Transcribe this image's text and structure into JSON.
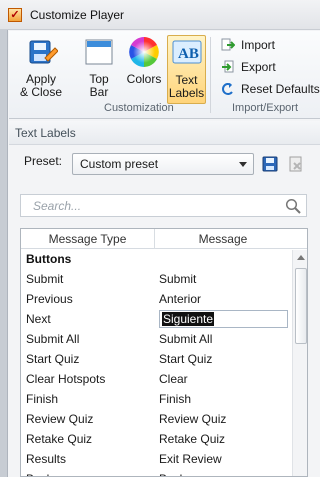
{
  "window": {
    "title": "Customize Player",
    "app_icon": "✓"
  },
  "ribbon": {
    "apply_label": "Apply\n& Close",
    "topbar_label": "Top\nBar",
    "colors_label": "Colors",
    "textlabels_label": "Text\nLabels",
    "customization_group": "Customization",
    "import_label": "Import",
    "export_label": "Export",
    "reset_label": "Reset Defaults",
    "importexport_group": "Import/Export"
  },
  "panel": {
    "title": "Text Labels"
  },
  "preset": {
    "label": "Preset:",
    "value": "Custom preset"
  },
  "search": {
    "placeholder": "Search..."
  },
  "grid": {
    "headers": [
      "Message Type",
      "Message"
    ],
    "group": "Buttons",
    "rows": [
      [
        "Submit",
        "Submit"
      ],
      [
        "Previous",
        "Anterior"
      ],
      [
        "Next",
        "Siguiente"
      ],
      [
        "Submit All",
        "Submit All"
      ],
      [
        "Start Quiz",
        "Start Quiz"
      ],
      [
        "Clear Hotspots",
        "Clear"
      ],
      [
        "Finish",
        "Finish"
      ],
      [
        "Review Quiz",
        "Review Quiz"
      ],
      [
        "Retake Quiz",
        "Retake Quiz"
      ],
      [
        "Results",
        "Exit Review"
      ],
      [
        "Back",
        "Back"
      ]
    ]
  },
  "colors": {
    "accent": "#ffd47a",
    "selection": "#000000",
    "ribbon": "#edf0f4"
  }
}
